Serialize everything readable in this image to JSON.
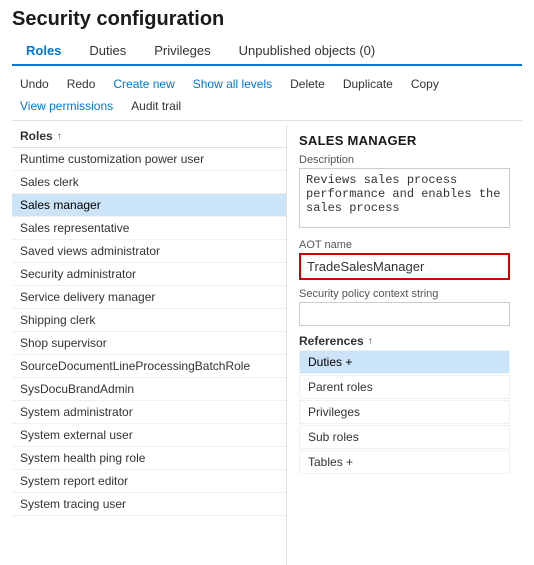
{
  "page": {
    "title": "Security configuration"
  },
  "tabs": [
    {
      "id": "roles",
      "label": "Roles",
      "active": true
    },
    {
      "id": "duties",
      "label": "Duties",
      "active": false
    },
    {
      "id": "privileges",
      "label": "Privileges",
      "active": false
    },
    {
      "id": "unpublished",
      "label": "Unpublished objects (0)",
      "active": false
    }
  ],
  "toolbar": {
    "undo": "Undo",
    "redo": "Redo",
    "create_new": "Create new",
    "show_all_levels": "Show all levels",
    "delete": "Delete",
    "duplicate": "Duplicate",
    "copy": "Copy",
    "view_permissions": "View permissions",
    "audit_trail": "Audit trail"
  },
  "list": {
    "header": "Roles",
    "sort_icon": "↑",
    "items": [
      {
        "id": 1,
        "label": "Runtime customization power user",
        "selected": false
      },
      {
        "id": 2,
        "label": "Sales clerk",
        "selected": false
      },
      {
        "id": 3,
        "label": "Sales manager",
        "selected": true
      },
      {
        "id": 4,
        "label": "Sales representative",
        "selected": false
      },
      {
        "id": 5,
        "label": "Saved views administrator",
        "selected": false
      },
      {
        "id": 6,
        "label": "Security administrator",
        "selected": false
      },
      {
        "id": 7,
        "label": "Service delivery manager",
        "selected": false
      },
      {
        "id": 8,
        "label": "Shipping clerk",
        "selected": false
      },
      {
        "id": 9,
        "label": "Shop supervisor",
        "selected": false
      },
      {
        "id": 10,
        "label": "SourceDocumentLineProcessingBatchRole",
        "selected": false
      },
      {
        "id": 11,
        "label": "SysDocuBrandAdmin",
        "selected": false
      },
      {
        "id": 12,
        "label": "System administrator",
        "selected": false
      },
      {
        "id": 13,
        "label": "System external user",
        "selected": false
      },
      {
        "id": 14,
        "label": "System health ping role",
        "selected": false
      },
      {
        "id": 15,
        "label": "System report editor",
        "selected": false
      },
      {
        "id": 16,
        "label": "System tracing user",
        "selected": false
      }
    ]
  },
  "detail": {
    "title": "SALES MANAGER",
    "description_label": "Description",
    "description_value": "Reviews sales process performance and enables the sales process",
    "aot_name_label": "AOT name",
    "aot_name_value": "TradeSalesManager",
    "security_policy_label": "Security policy context string",
    "security_policy_value": "",
    "references_label": "References",
    "references_sort_icon": "↑",
    "references": [
      {
        "id": 1,
        "label": "Duties +",
        "selected": true
      },
      {
        "id": 2,
        "label": "Parent roles",
        "selected": false
      },
      {
        "id": 3,
        "label": "Privileges",
        "selected": false
      },
      {
        "id": 4,
        "label": "Sub roles",
        "selected": false
      },
      {
        "id": 5,
        "label": "Tables +",
        "selected": false
      }
    ]
  }
}
